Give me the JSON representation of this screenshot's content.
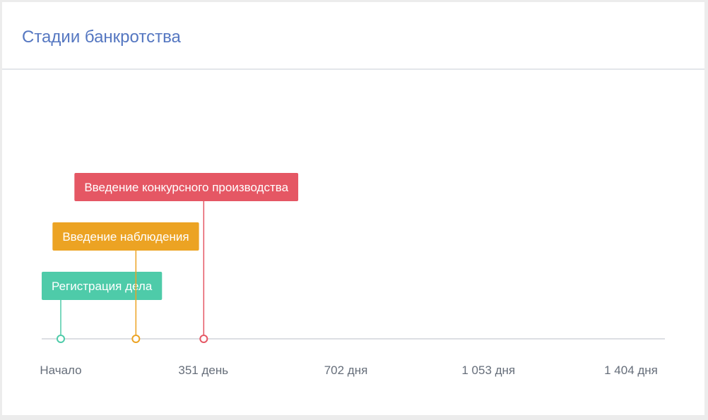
{
  "header": {
    "title": "Стадии банкротства"
  },
  "colors": {
    "title": "#5577c1",
    "axis": "#dcdfe3",
    "tick_text": "#666e7a"
  },
  "chart_data": {
    "type": "timeline",
    "title": "",
    "x_unit": "days",
    "xlim": [
      0,
      1404
    ],
    "ticks": [
      {
        "value": 0,
        "label": "Начало"
      },
      {
        "value": 351,
        "label": "351 день"
      },
      {
        "value": 702,
        "label": "702 дня"
      },
      {
        "value": 1053,
        "label": "1 053 дня"
      },
      {
        "value": 1404,
        "label": "1 404 дня"
      }
    ],
    "events": [
      {
        "label": "Регистрация дела",
        "day": 0,
        "color": "#4ecba9"
      },
      {
        "label": "Введение наблюдения",
        "day": 185,
        "color": "#eca323"
      },
      {
        "label": "Введение конкурсного производства",
        "day": 352,
        "color": "#e55764"
      }
    ]
  }
}
